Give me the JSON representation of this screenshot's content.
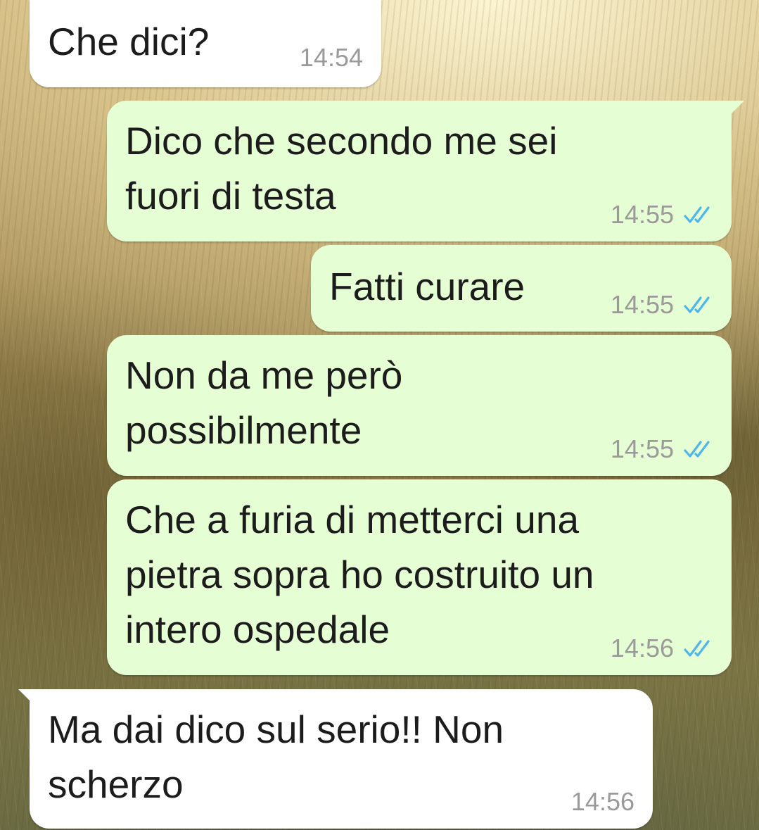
{
  "chat": {
    "messages": [
      {
        "direction": "incoming",
        "text": "Che dici?",
        "time": "14:54"
      },
      {
        "direction": "outgoing",
        "text": "Dico che secondo me sei\nfuori di testa",
        "time": "14:55",
        "status": "read",
        "status_icon": "double-check-icon"
      },
      {
        "direction": "outgoing",
        "text": "Fatti curare",
        "time": "14:55",
        "status": "read",
        "status_icon": "double-check-icon"
      },
      {
        "direction": "outgoing",
        "text": "Non da me però\npossibilmente",
        "time": "14:55",
        "status": "read",
        "status_icon": "double-check-icon"
      },
      {
        "direction": "outgoing",
        "text": "Che a furia di metterci una\npietra sopra ho costruito un\nintero ospedale",
        "time": "14:56",
        "status": "read",
        "status_icon": "double-check-icon"
      },
      {
        "direction": "incoming",
        "text": "Ma dai dico sul serio!! Non\nscherzo",
        "time": "14:56"
      }
    ]
  },
  "colors": {
    "incoming_bubble": "#ffffff",
    "outgoing_bubble": "#e6fed4",
    "read_ticks": "#4fb6ec",
    "timestamp": "#9a9a9a"
  }
}
